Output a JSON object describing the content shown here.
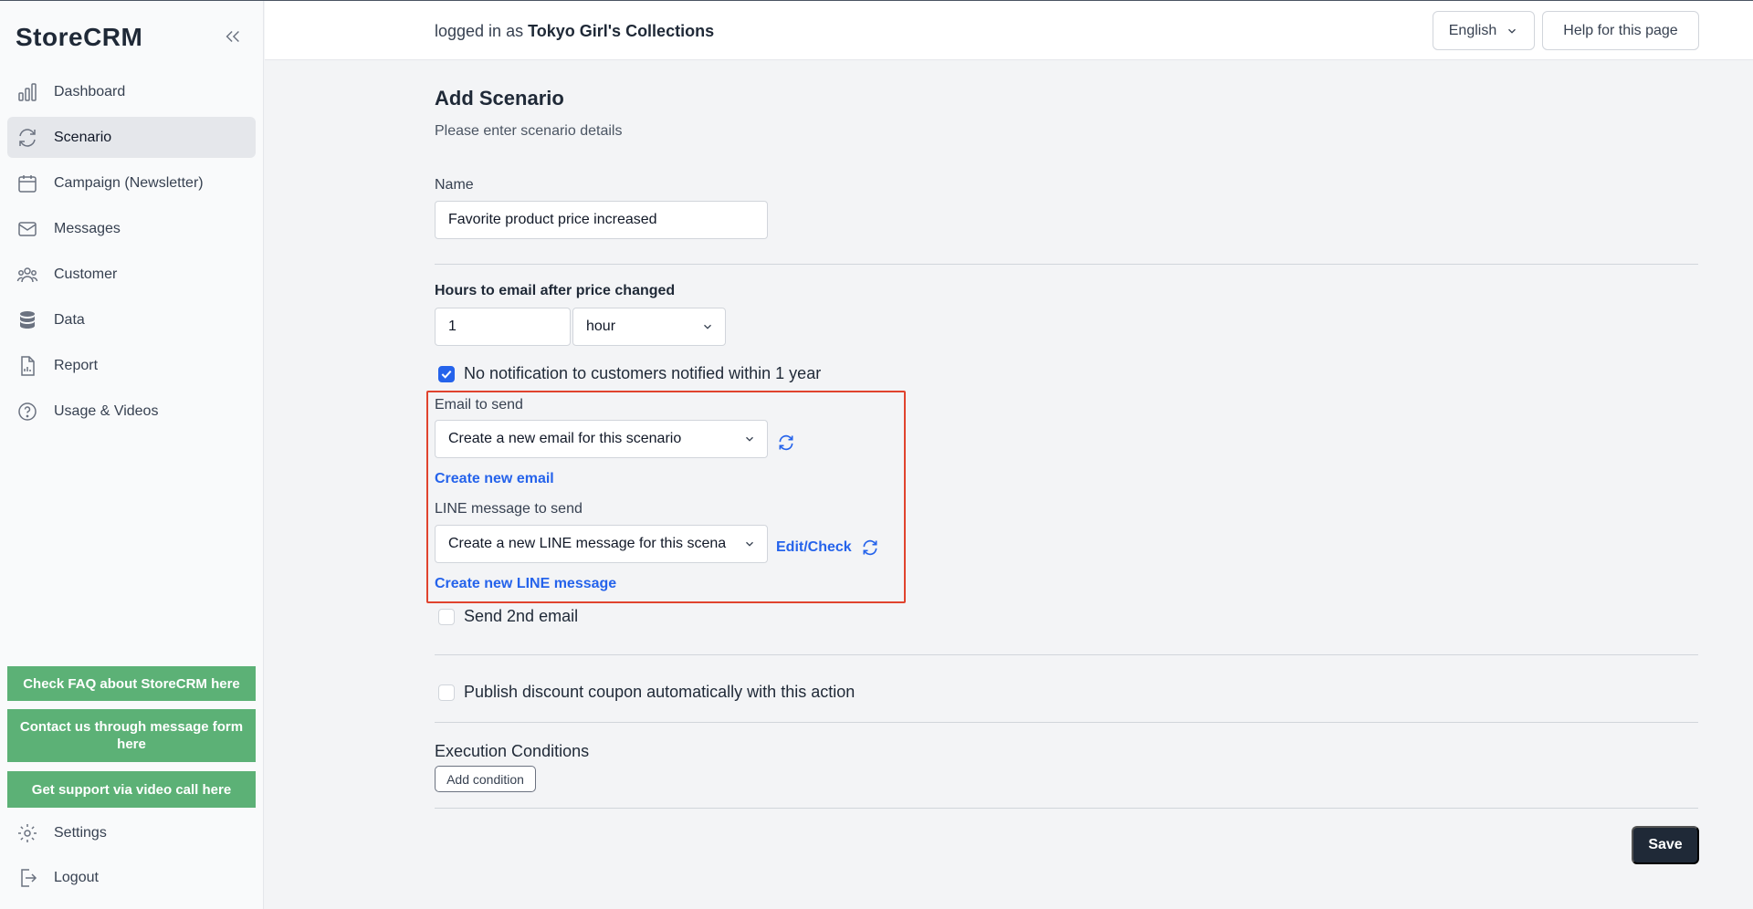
{
  "app": {
    "brand": "StoreCRM"
  },
  "sidebar": {
    "items": [
      {
        "label": "Dashboard",
        "icon": "bar-chart-icon"
      },
      {
        "label": "Scenario",
        "icon": "refresh-cycle-icon",
        "active": true
      },
      {
        "label": "Campaign (Newsletter)",
        "icon": "calendar-icon"
      },
      {
        "label": "Messages",
        "icon": "envelope-icon"
      },
      {
        "label": "Customer",
        "icon": "users-icon"
      },
      {
        "label": "Data",
        "icon": "database-icon"
      },
      {
        "label": "Report",
        "icon": "document-chart-icon"
      },
      {
        "label": "Usage & Videos",
        "icon": "question-circle-icon"
      }
    ],
    "support_buttons": {
      "faq": "Check FAQ about StoreCRM here",
      "contact": "Contact us through message form here",
      "video_call": "Get support via video call here"
    },
    "bottom_items": [
      {
        "label": "Settings",
        "icon": "gear-icon"
      },
      {
        "label": "Logout",
        "icon": "logout-icon"
      }
    ],
    "support_color": "#5cb176"
  },
  "header": {
    "logged_in_prefix": "logged in as",
    "account_name": "Tokyo Girl's Collections",
    "language": "English",
    "help": "Help for this page"
  },
  "form": {
    "title": "Add Scenario",
    "subtitle": "Please enter scenario details",
    "name_label": "Name",
    "name_value": "Favorite product price increased",
    "hours_label": "Hours to email after price changed",
    "hours_value": "1",
    "unit_value": "hour",
    "no_notify_label": "No notification to customers notified within 1 year",
    "no_notify_checked": true,
    "email_label": "Email to send",
    "email_select": "Create a new email for this scenario",
    "create_email_link": "Create new email",
    "line_label": "LINE message to send",
    "line_select": "Create a new LINE message for this scenario",
    "edit_check_link": "Edit/Check",
    "create_line_link": "Create new LINE message",
    "second_email_label": "Send 2nd email",
    "second_email_checked": false,
    "coupon_label": "Publish discount coupon automatically with this action",
    "coupon_checked": false,
    "conditions_title": "Execution Conditions",
    "add_condition": "Add condition",
    "save": "Save",
    "highlight_color": "#e0432e",
    "accent_color": "#2563eb"
  }
}
